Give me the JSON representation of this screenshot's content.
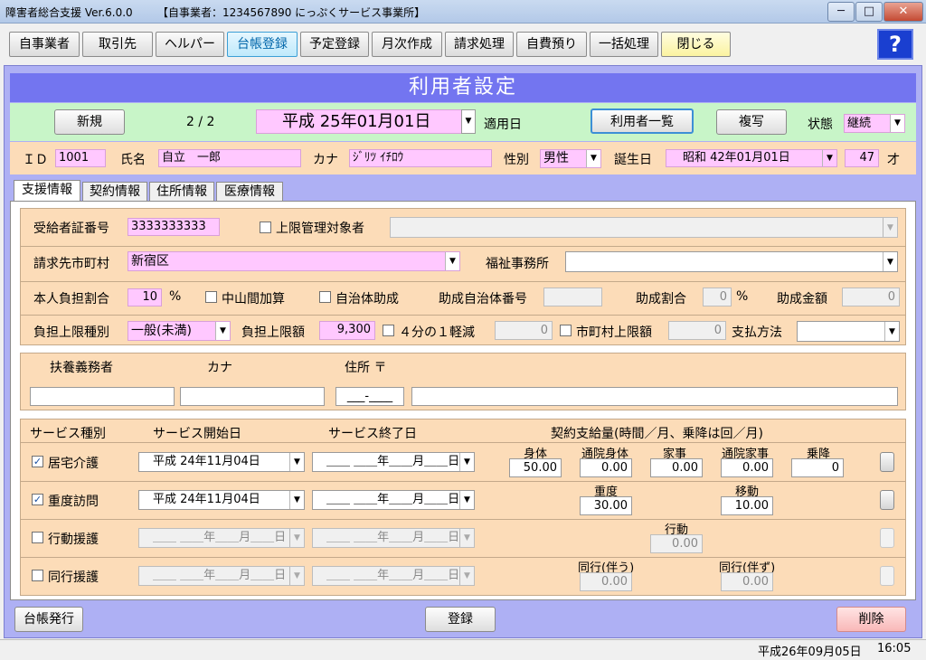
{
  "window": {
    "title": "障害者総合支援 Ver.6.0.0",
    "company": "【自事業者：1234567890 にっぷくサービス事業所】",
    "min": "─",
    "max": "□",
    "close": "✕"
  },
  "toolbar": {
    "items": [
      "自事業者",
      "取引先",
      "ヘルパー",
      "台帳登録",
      "予定登録",
      "月次作成",
      "請求処理",
      "自費預り",
      "一括処理",
      "閉じる"
    ],
    "help": "?"
  },
  "header": {
    "title": "利用者設定"
  },
  "top": {
    "new_label": "新規",
    "page": "2 / 2",
    "apply_date": "平成 25年01月01日",
    "apply_label": "適用日",
    "list_label": "利用者一覧",
    "copy_label": "複写",
    "status_label": "状態",
    "status_value": "継続"
  },
  "ident": {
    "id_label": "ＩＤ",
    "id_value": "1001",
    "name_label": "氏名",
    "name_value": "自立　一郎",
    "kana_label": "カナ",
    "kana_value": "ｼﾞﾘﾂ ｲﾁﾛｳ",
    "sex_label": "性別",
    "sex_value": "男性",
    "birth_label": "誕生日",
    "birth_value": "昭和 42年01月01日",
    "age_value": "47",
    "age_unit": "才"
  },
  "tabs": [
    "支援情報",
    "契約情報",
    "住所情報",
    "医療情報"
  ],
  "sec1": {
    "cert_label": "受給者証番号",
    "cert_value": "3333333333",
    "limit_mgmt_label": "上限管理対象者",
    "city_label": "請求先市町村",
    "city_value": "新宿区",
    "welfare_label": "福祉事務所",
    "burden_label": "本人負担割合",
    "burden_value": "10",
    "percent": "%",
    "mid_label": "中山間加算",
    "local_label": "自治体助成",
    "local_no_label": "助成自治体番号",
    "aid_rate_label": "助成割合",
    "aid_rate_value": "0",
    "aid_amount_label": "助成金額",
    "aid_amount_value": "0",
    "limit_type_label": "負担上限種別",
    "limit_type_value": "一般(未満)",
    "limit_amount_label": "負担上限額",
    "limit_amount_value": "9,300",
    "quarter_label": "４分の１軽減",
    "quarter_value": "0",
    "city_limit_label": "市町村上限額",
    "city_limit_value": "0",
    "pay_label": "支払方法"
  },
  "sec2": {
    "guardian_label": "扶養義務者",
    "kana_label": "カナ",
    "addr_label": "住所 〒",
    "zip_placeholder": "___-____"
  },
  "sec3": {
    "col_type": "サービス種別",
    "col_start": "サービス開始日",
    "col_end": "サービス終了日",
    "col_amount": "契約支給量(時間／月、乗降は回／月)",
    "empty_date": "＿＿ ＿＿年＿＿月＿＿日",
    "rows": [
      {
        "name": "居宅介護",
        "checked": true,
        "start": "平成 24年11月04日"
      },
      {
        "name": "重度訪問",
        "checked": true,
        "start": "平成 24年11月04日"
      },
      {
        "name": "行動援護",
        "checked": false,
        "start": "＿＿ ＿＿年＿＿月＿＿日"
      },
      {
        "name": "同行援護",
        "checked": false,
        "start": "＿＿ ＿＿年＿＿月＿＿日"
      }
    ],
    "r1": {
      "labels": [
        "身体",
        "通院身体",
        "家事",
        "通院家事",
        "乗降"
      ],
      "values": [
        "50.00",
        "0.00",
        "0.00",
        "0.00",
        "0"
      ]
    },
    "r2": {
      "labels": [
        "重度",
        "移動"
      ],
      "values": [
        "30.00",
        "10.00"
      ]
    },
    "r3": {
      "labels": [
        "行動"
      ],
      "values": [
        "0.00"
      ]
    },
    "r4": {
      "labels": [
        "同行(伴う)",
        "同行(伴ず)"
      ],
      "values": [
        "0.00",
        "0.00"
      ]
    }
  },
  "footer": {
    "print_label": "台帳発行",
    "register_label": "登録",
    "delete_label": "削除"
  },
  "status": {
    "date": "平成26年09月05日",
    "time": "16:05"
  }
}
